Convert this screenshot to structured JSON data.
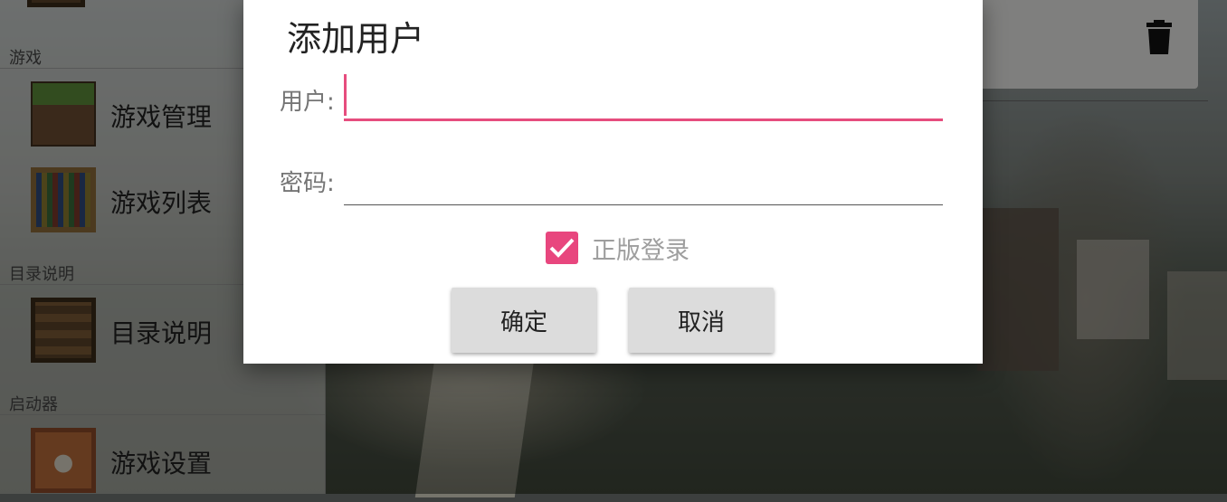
{
  "sidebar": {
    "sections": [
      {
        "header": "游戏",
        "items": [
          {
            "label": "游戏管理",
            "icon": "grass-block-icon"
          },
          {
            "label": "游戏列表",
            "icon": "bookshelf-icon"
          }
        ]
      },
      {
        "header": "目录说明",
        "items": [
          {
            "label": "目录说明",
            "icon": "crafting-table-icon"
          }
        ]
      },
      {
        "header": "启动器",
        "items": [
          {
            "label": "游戏设置",
            "icon": "command-block-icon"
          }
        ]
      }
    ]
  },
  "account_card": {
    "delete_icon": "trash-icon"
  },
  "dialog": {
    "title": "添加用户",
    "user_label": "用户:",
    "user_value": "",
    "password_label": "密码:",
    "password_value": "",
    "checkbox_label": "正版登录",
    "checkbox_checked": true,
    "ok_button": "确定",
    "cancel_button": "取消"
  },
  "colors": {
    "accent": "#e8467e",
    "button_bg": "#dcdcdc",
    "scrim": "rgba(0,0,0,0.45)"
  }
}
